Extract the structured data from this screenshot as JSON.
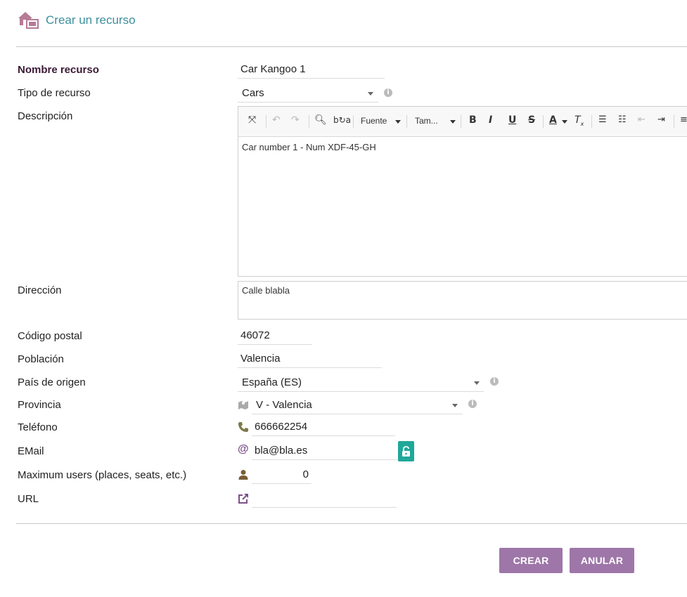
{
  "header": {
    "title": "Crear un recurso"
  },
  "form": {
    "nombre": {
      "label": "Nombre recurso",
      "value": "Car Kangoo 1"
    },
    "tipo": {
      "label": "Tipo de recurso",
      "value": "Cars"
    },
    "descripcion": {
      "label": "Descripción",
      "content": "Car number 1 - Num XDF-45-GH",
      "toolbar": {
        "font_label": "Fuente",
        "size_label": "Tam..."
      }
    },
    "direccion": {
      "label": "Dirección",
      "value": "Calle blabla"
    },
    "codigo_postal": {
      "label": "Código postal",
      "value": "46072"
    },
    "poblacion": {
      "label": "Población",
      "value": "Valencia"
    },
    "pais": {
      "label": "País de origen",
      "value": "España (ES)"
    },
    "provincia": {
      "label": "Provincia",
      "value": "V - Valencia"
    },
    "telefono": {
      "label": "Teléfono",
      "value": "666662254"
    },
    "email": {
      "label": "EMail",
      "value": "bla@bla.es"
    },
    "max_users": {
      "label": "Maximum users (places, seats, etc.)",
      "value": "0"
    },
    "url": {
      "label": "URL",
      "value": ""
    }
  },
  "actions": {
    "create_label": "CREAR",
    "cancel_label": "ANULAR"
  },
  "icons": {
    "header": "building-icon",
    "phone": "phone-icon",
    "email": "at-icon",
    "users": "user-icon",
    "url": "external-link-icon",
    "map": "map-icon",
    "lock": "lock-icon"
  },
  "colors": {
    "accent": "#9e76a8",
    "title": "#3d8f9c",
    "lock": "#1fa89a"
  }
}
